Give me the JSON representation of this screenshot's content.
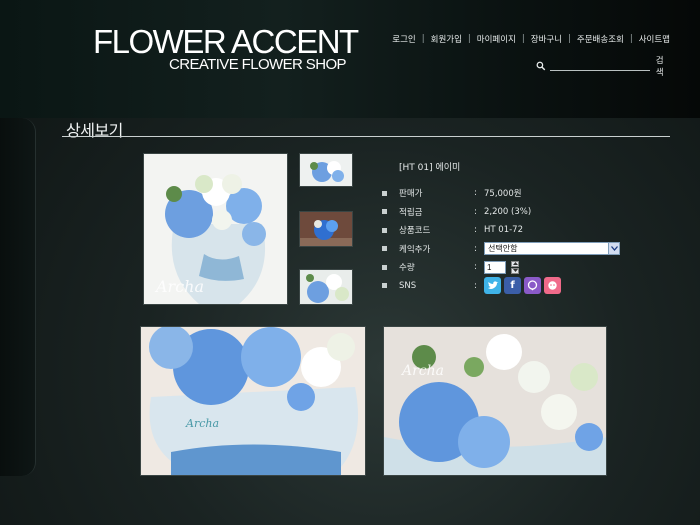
{
  "header": {
    "logo_title": "FLOWER ACCENT",
    "logo_subtitle": "CREATIVE FLOWER SHOP",
    "nav": [
      "로그인",
      "회원가입",
      "마이페이지",
      "장바구니",
      "주문배송조회",
      "사이트맵"
    ],
    "search_placeholder": "",
    "search_button": "검색"
  },
  "page": {
    "title": "상세보기"
  },
  "product": {
    "name": "[HT 01] 에이미",
    "fields": [
      {
        "label": "판매가",
        "value": "75,000원"
      },
      {
        "label": "적립금",
        "value": "2,200 (3%)"
      },
      {
        "label": "상품코드",
        "value": "HT 01-72"
      },
      {
        "label": "케익추가",
        "value": "선택안함"
      },
      {
        "label": "수량",
        "value": "1"
      },
      {
        "label": "SNS",
        "value": ""
      }
    ],
    "sns_icons": [
      "twitter-icon",
      "facebook-icon",
      "naver-blog-icon",
      "kakao-icon"
    ],
    "photo_watermark": "Archa",
    "colors": {
      "hydrangea": "#6d9fe0",
      "accent": "#7f9db9"
    }
  }
}
